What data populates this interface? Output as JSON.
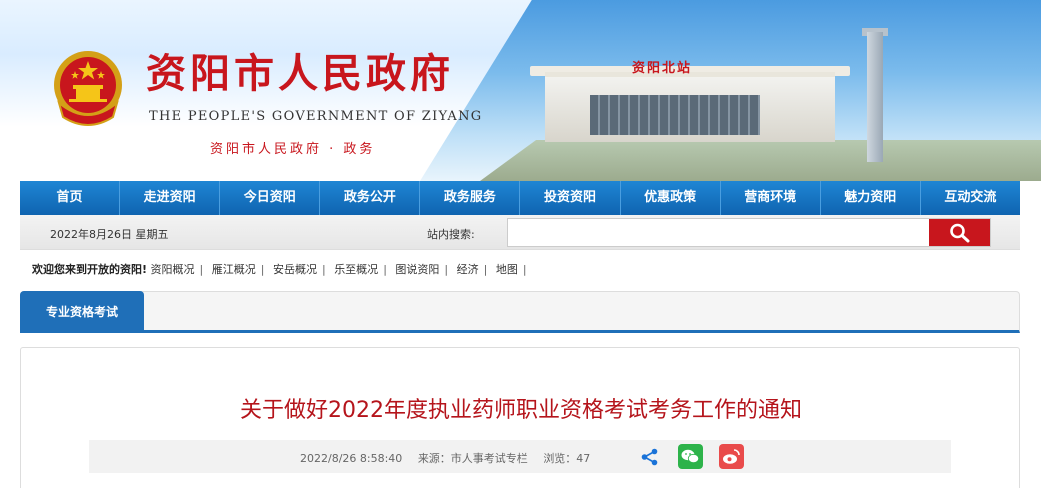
{
  "header": {
    "title": "资阳市人民政府",
    "subtitle": "THE PEOPLE'S GOVERNMENT OF ZIYANG",
    "tagline": "资阳市人民政府 · 政务",
    "station_sign": "资阳北站"
  },
  "nav": {
    "items": [
      "首页",
      "走进资阳",
      "今日资阳",
      "政务公开",
      "政务服务",
      "投资资阳",
      "优惠政策",
      "营商环境",
      "魅力资阳",
      "互动交流"
    ]
  },
  "search": {
    "date": "2022年8月26日 星期五",
    "label": "站内搜索:",
    "value": "",
    "button_icon": "search-icon"
  },
  "welcome": {
    "lead": "欢迎您来到开放的资阳!",
    "links": [
      "资阳概况",
      "雁江概况",
      "安岳概况",
      "乐至概况",
      "图说资阳",
      "经济",
      "地图"
    ]
  },
  "tabs": {
    "active": "专业资格考试"
  },
  "article": {
    "title": "关于做好2022年度执业药师职业资格考试考务工作的通知",
    "datetime": "2022/8/26 8:58:40",
    "source": "来源：市人事考试专栏",
    "views": "浏览：47",
    "share_icons": [
      "share-icon",
      "wechat-icon",
      "weibo-icon"
    ]
  },
  "colors": {
    "brand_red": "#c8161d",
    "nav_blue": "#0f64b0",
    "title_red": "#b5141b"
  }
}
